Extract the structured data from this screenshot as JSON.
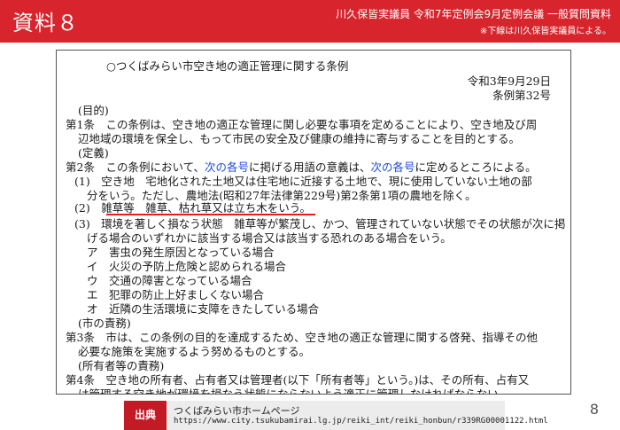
{
  "header": {
    "label": "資料８",
    "title": "川久保皆実議員 令和7年定例会9月定例会議 一般質問資料",
    "note": "※下線は川久保皆実議員による。"
  },
  "doc": {
    "lines": [
      "○つくばみらい市空き地の適正管理に関する条例",
      "令和3年9月29日",
      "条例第32号",
      "(目的)",
      "第1条　この条例は、空き地の適正な管理に関し必要な事項を定めることにより、空き地及び周",
      "辺地域の環境を保全し、もって市民の安全及び健康の維持に寄与することを目的とする。",
      "(定義)",
      "第2条　この条例において、",
      "次の各号",
      "に掲げる用語の意義は、",
      "次の各号",
      "に定めるところによる。",
      "(1)　空き地　宅地化された土地又は住宅地に近接する土地で、現に使用していない土地の部",
      "分をいう。ただし、農地法(昭和27年法律第229号)第2条第1項の農地を除く。",
      "(2)　雑草等　雑草、枯れ草又は立ち木をいう。",
      "(3)　環境を著しく損なう状態　雑草等が繁茂し、かつ、管理されていない状態でその状態が次に掲",
      "げる場合のいずれかに該当する場合又は該当する恐れのある場合をいう。",
      "ア　害虫の発生原因となっている場合",
      "イ　火災の予防上危険と認められる場合",
      "ウ　交通の障害となっている場合",
      "エ　犯罪の防止上好ましくない場合",
      "オ　近隣の生活環境に支障をきたしている場合",
      "(市の責務)",
      "第3条　市は、この条例の目的を達成するため、空き地の適正な管理に関する啓発、指導その他",
      "必要な施策を実施するよう努めるものとする。",
      "(所有者等の責務)",
      "第4条　空き地の所有者、占有者又は管理者(以下「所有者等」という。)は、その所有、占有又",
      "は管理する空き地が環境を損なう状態にならないよう適正に管理しなければならない。"
    ]
  },
  "footer": {
    "badge": "出典",
    "source": "つくばみらい市ホームページ",
    "url": "https://www.city.tsukubamirai.lg.jp/reiki_int/reiki_honbun/r339RG00001122.html"
  },
  "page_number": "8",
  "colors": {
    "accent": "#d7242d",
    "link": "#1f4bd8",
    "underline": "#e02020"
  }
}
